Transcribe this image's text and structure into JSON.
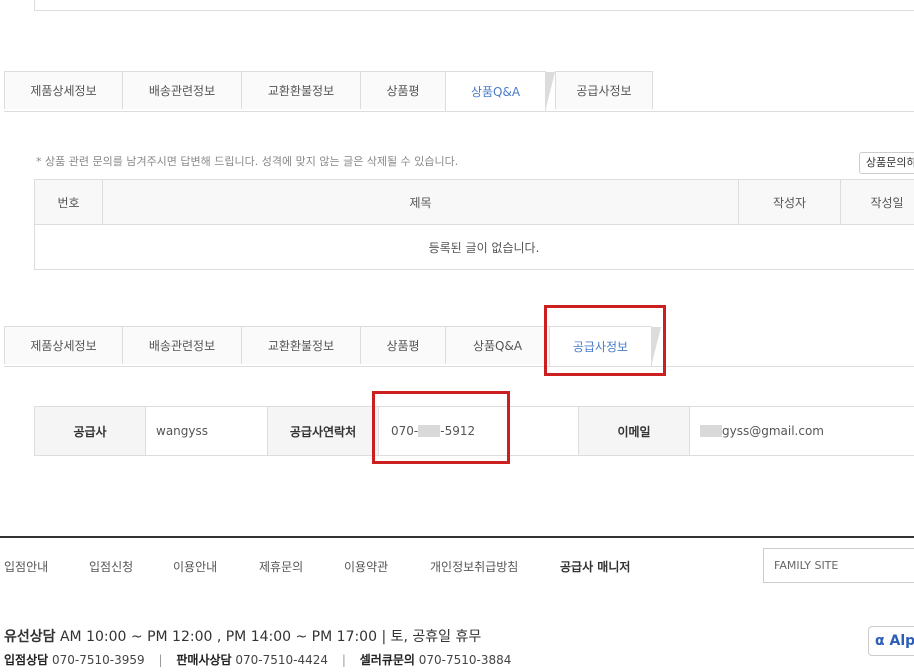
{
  "tabs": [
    {
      "label": "제품상세정보"
    },
    {
      "label": "배송관련정보"
    },
    {
      "label": "교환환불정보"
    },
    {
      "label": "상품평"
    },
    {
      "label": "상품Q&A"
    },
    {
      "label": "공급사정보"
    }
  ],
  "qa": {
    "notice": "* 상품 관련 문의를 남겨주시면 답변해 드립니다. 성격에 맞지 않는 글은 삭제될 수 있습니다.",
    "write_button": "상품문의하기",
    "columns": [
      "번호",
      "제목",
      "작성자",
      "작성일"
    ],
    "empty": "등록된 글이 없습니다."
  },
  "supplier": {
    "name_label": "공급사",
    "name": "wangyss",
    "contact_label": "공급사연락처",
    "contact_prefix": "070-",
    "contact_suffix": "-5912",
    "email_label": "이메일",
    "email": "gyss@gmail.com"
  },
  "footer": {
    "nav": [
      "입점안내",
      "입점신청",
      "이용안내",
      "제휴문의",
      "이용약관",
      "개인정보취급방침",
      "공급사 매니저"
    ],
    "family_site": "FAMILY SITE",
    "cs_line1_label": "유선상담",
    "cs_line1_text": "AM 10:00 ~ PM 12:00 , PM 14:00 ~ PM 17:00 |   토, 공휴일 휴무",
    "cs": [
      {
        "label": "입점상담",
        "phone": "070-7510-3959"
      },
      {
        "label": "판매사상담",
        "phone": "070-7510-4424"
      },
      {
        "label": "셀러큐문의",
        "phone": "070-7510-3884"
      }
    ],
    "badge": "α Alp"
  },
  "colors": {
    "accent_tab": "#4a7cc9",
    "highlight": "#cc1f1f"
  }
}
